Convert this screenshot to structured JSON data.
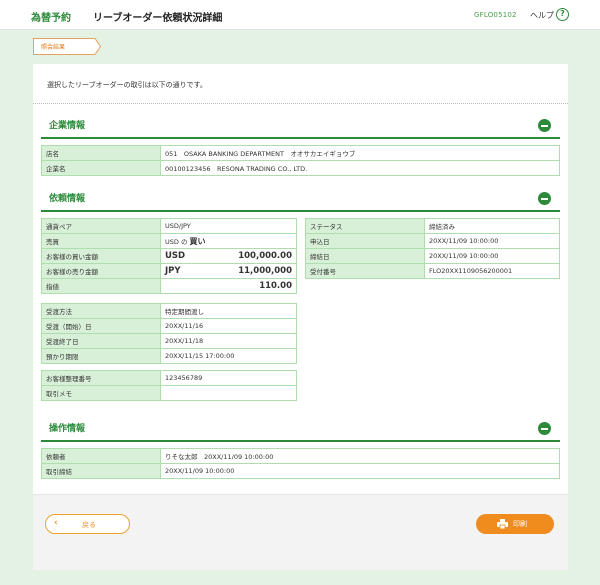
{
  "header": {
    "logo": "為替予約",
    "title": "リーブオーダー依頼状況詳細",
    "screen_id": "GFLO05102",
    "help_label": "ヘルプ",
    "help_icon": "?"
  },
  "step": {
    "label": "照会結果"
  },
  "intro": "選択したリーブオーダーの取引は以下の通りです。",
  "company": {
    "title": "企業情報",
    "rows": [
      {
        "label": "店名",
        "value": "051　OSAKA BANKING DEPARTMENT　オオサカエイギョウブ"
      },
      {
        "label": "企業名",
        "value": "00100123456　RESONA TRADING CO., LTD."
      }
    ]
  },
  "request": {
    "title": "依頼情報",
    "pair_label": "通貨ペア",
    "pair": "USD/JPY",
    "side_label": "売買",
    "side_prefix": "USD の",
    "side": "買い",
    "buy_label": "お客様の買い金額",
    "buy_ccy": "USD",
    "buy_amount": "100,000.00",
    "sell_label": "お客様の売り金額",
    "sell_ccy": "JPY",
    "sell_amount": "11,000,000",
    "rate_label": "指値",
    "rate": "110.00",
    "delivery_method_label": "受渡方法",
    "delivery_method": "特定期間渡し",
    "delivery_start_label": "受渡（開始）日",
    "delivery_start": "20XX/11/16",
    "delivery_end_label": "受渡終了日",
    "delivery_end": "20XX/11/18",
    "expiry_label": "預かり期限",
    "expiry": "20XX/11/15 17:00:00",
    "ref_label": "お客様整理番号",
    "ref": "123456789",
    "memo_label": "取引メモ",
    "memo": "",
    "status_label": "ステータス",
    "status": "締結済み",
    "applied_label": "申込日",
    "applied": "20XX/11/09 10:00:00",
    "contracted_label": "締結日",
    "contracted": "20XX/11/09 10:00:00",
    "receipt_label": "受付番号",
    "receipt": "FLO20XX1109056200001"
  },
  "ops": {
    "title": "操作情報",
    "rows": [
      {
        "label": "依頼者",
        "value": "りそな太郎　20XX/11/09 10:00:00"
      },
      {
        "label": "取引締結",
        "value": "20XX/11/09 10:00:00"
      }
    ]
  },
  "buttons": {
    "back": "戻る",
    "print": "印刷"
  },
  "colors": {
    "accent_green": "#2c8a3a",
    "label_bg": "#d8f0d8",
    "orange": "#f08c1e"
  }
}
